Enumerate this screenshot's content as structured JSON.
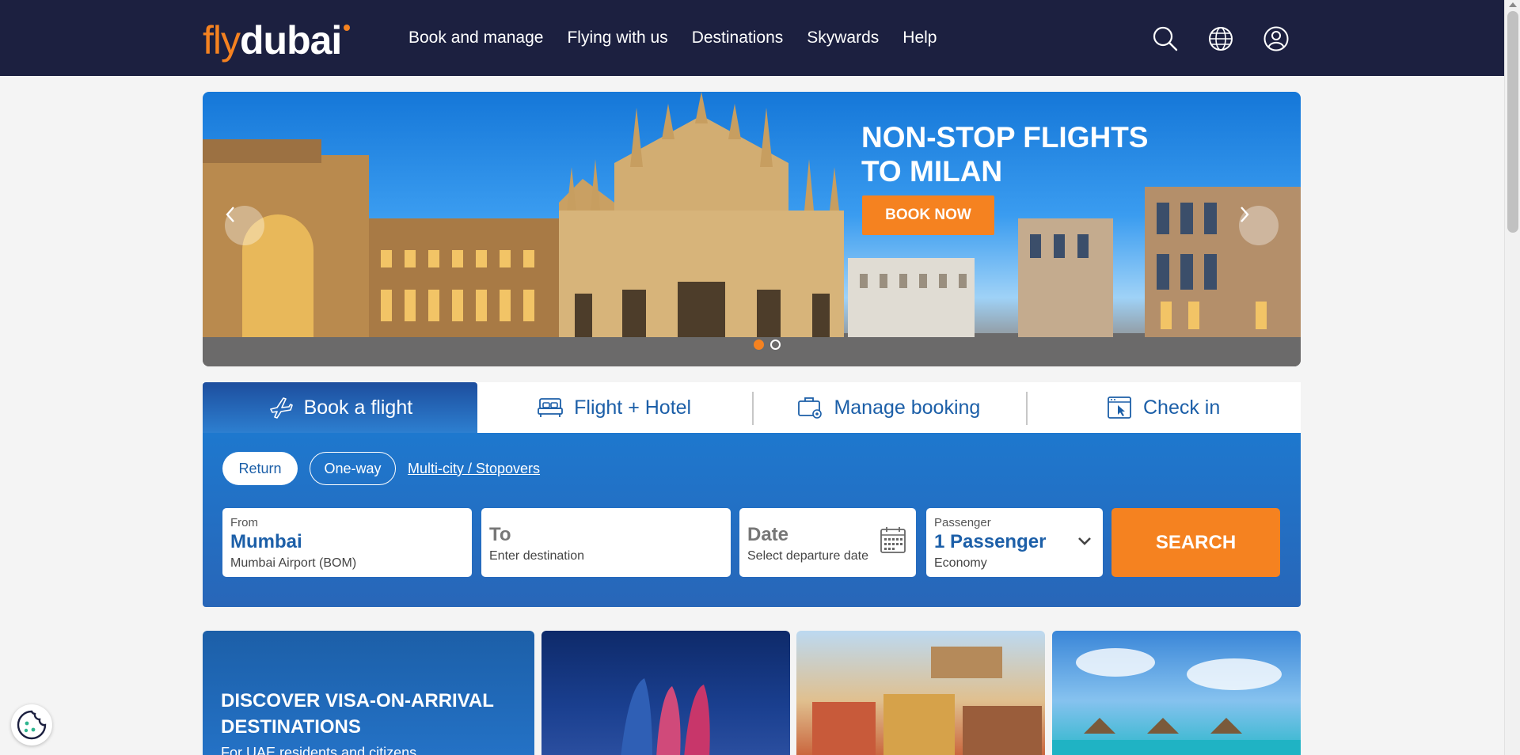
{
  "brand": {
    "logo_fly": "fly",
    "logo_dubai": "dubai",
    "accent": "#f58220",
    "navy": "#1c2040",
    "blue": "#1c5fa8"
  },
  "nav": {
    "items": [
      {
        "label": "Book and manage"
      },
      {
        "label": "Flying with us"
      },
      {
        "label": "Destinations"
      },
      {
        "label": "Skywards"
      },
      {
        "label": "Help"
      }
    ],
    "icons": [
      "search-icon",
      "globe-icon",
      "account-icon"
    ]
  },
  "hero": {
    "title": "NON-STOP FLIGHTS\nTO MILAN",
    "cta": "BOOK NOW",
    "slides_total": 2,
    "active_slide": 1
  },
  "booking": {
    "tabs": [
      {
        "label": "Book a flight",
        "icon": "plane-icon",
        "active": true
      },
      {
        "label": "Flight + Hotel",
        "icon": "bed-icon",
        "active": false
      },
      {
        "label": "Manage booking",
        "icon": "briefcase-icon",
        "active": false
      },
      {
        "label": "Check in",
        "icon": "checkin-icon",
        "active": false
      }
    ],
    "trip_types": {
      "return": "Return",
      "oneway": "One-way",
      "multicity": "Multi-city / Stopovers",
      "selected": "Return"
    },
    "from": {
      "label": "From",
      "value": "Mumbai",
      "sub": "Mumbai Airport (BOM)"
    },
    "to": {
      "value": "To",
      "sub": "Enter destination"
    },
    "date": {
      "value": "Date",
      "sub": "Select departure date"
    },
    "passenger": {
      "label": "Passenger",
      "value": "1 Passenger",
      "sub": "Economy"
    },
    "search_label": "SEARCH"
  },
  "promos": {
    "visa": {
      "title": "DISCOVER VISA-ON-ARRIVAL\nDESTINATIONS",
      "sub": "For UAE residents and citizens"
    }
  }
}
